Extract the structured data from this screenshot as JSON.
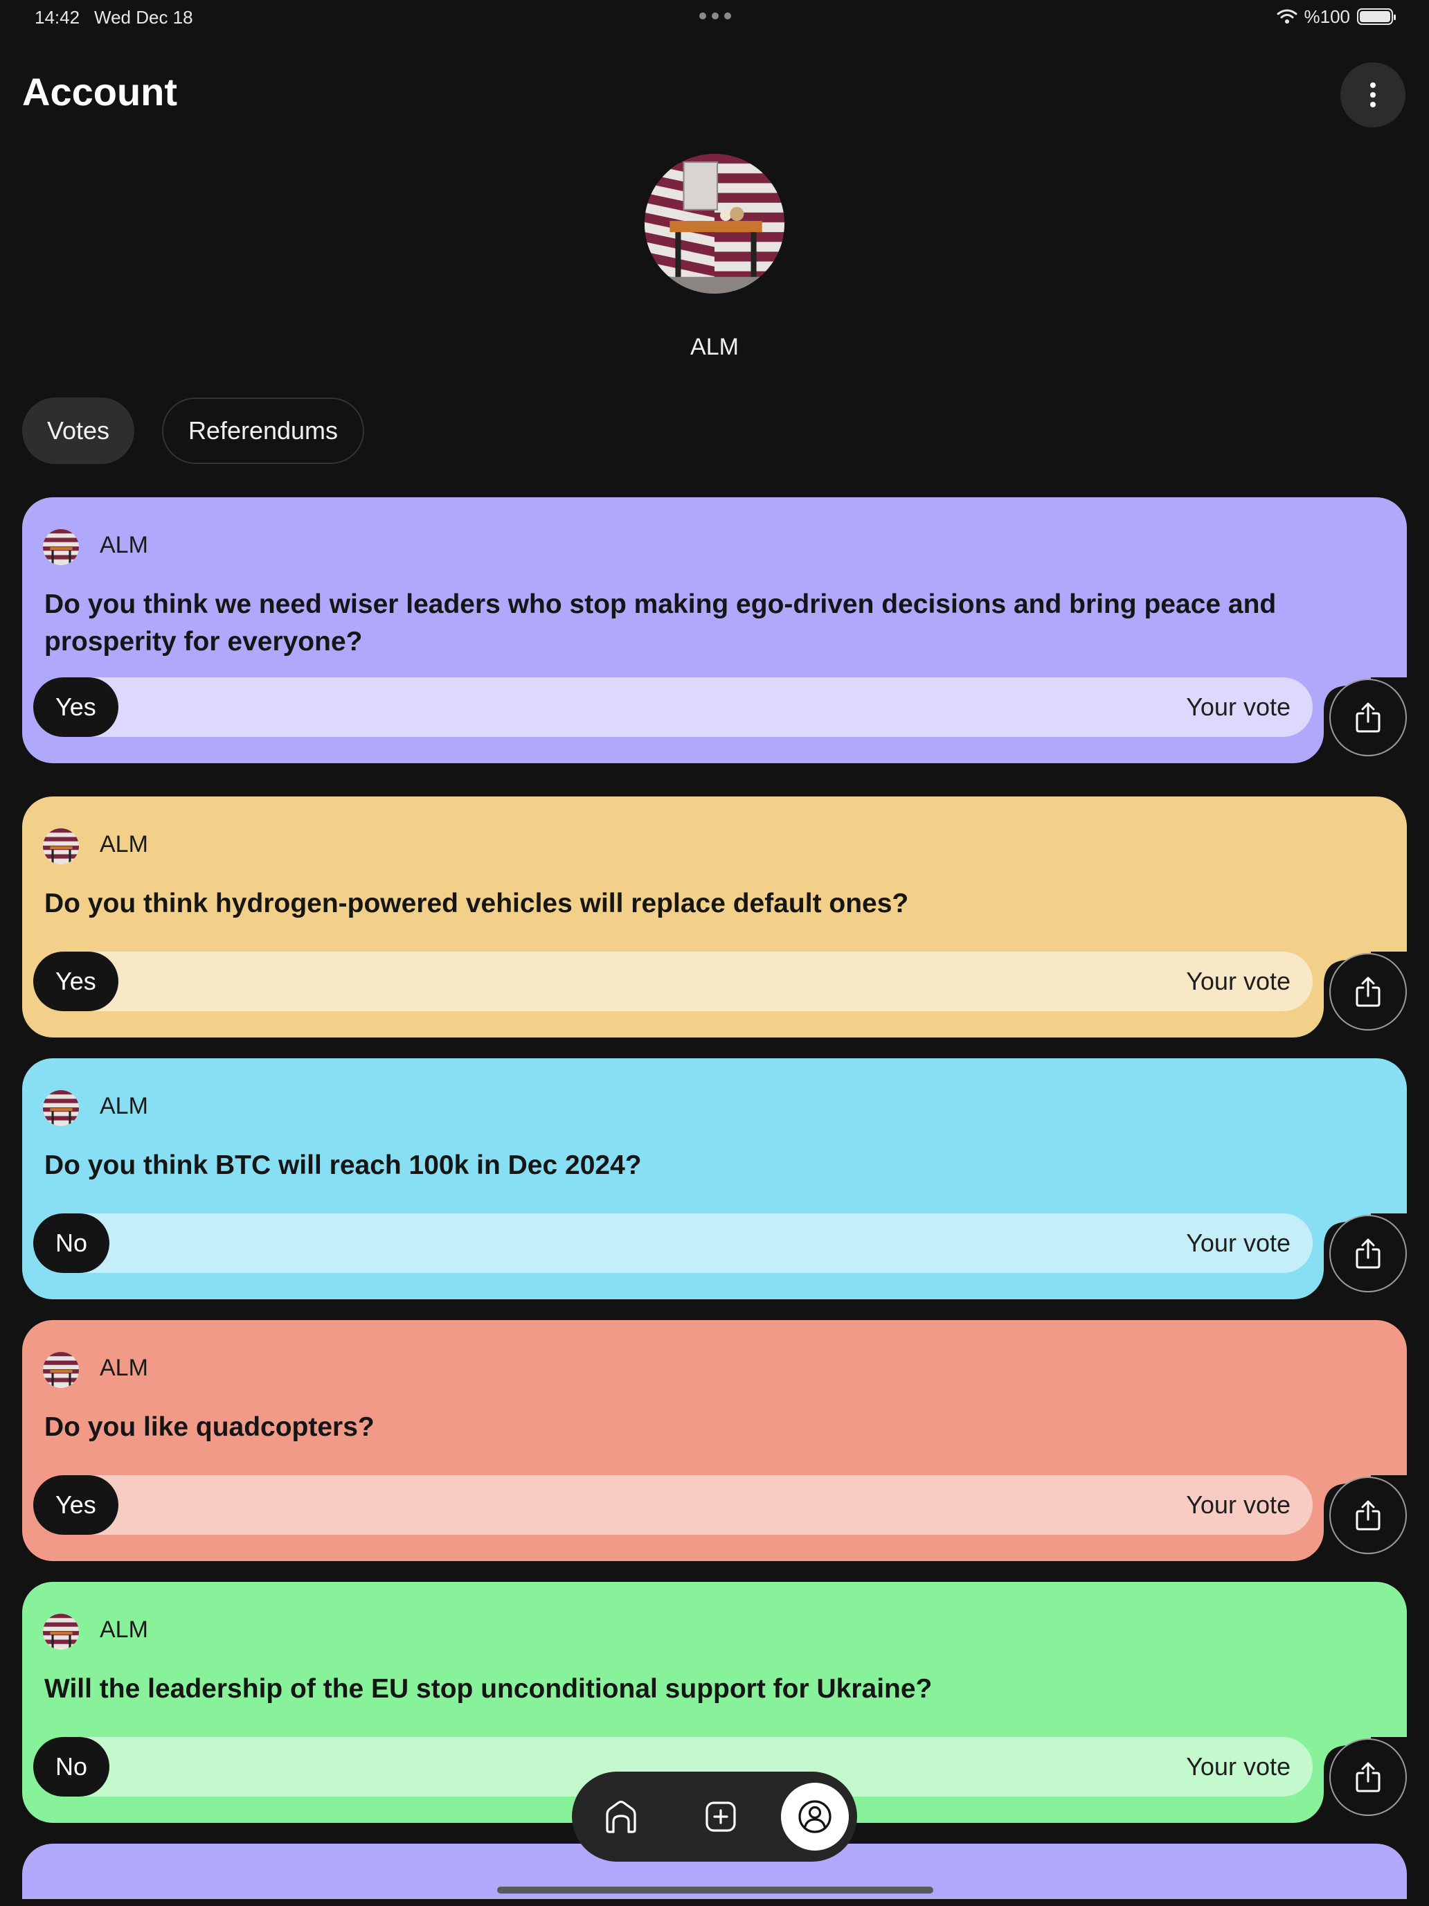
{
  "status_bar": {
    "time": "14:42",
    "date": "Wed Dec 18",
    "battery": "%100"
  },
  "header": {
    "title": "Account",
    "more_icon": "more-vertical-icon"
  },
  "profile": {
    "username": "ALM"
  },
  "tabs": [
    {
      "label": "Votes",
      "active": true
    },
    {
      "label": "Referendums",
      "active": false
    }
  ],
  "cards": [
    {
      "author": "ALM",
      "question": "Do you think we need wiser leaders who stop making ego-driven decisions and bring peace and prosperity for everyone?",
      "answer": "Yes",
      "vote_label": "Your vote",
      "color": "#b0a8fb",
      "bar_color": "#dcd8fe"
    },
    {
      "author": "ALM",
      "question": "Do you think hydrogen-powered vehicles will replace default ones?",
      "answer": "Yes",
      "vote_label": "Your vote",
      "color": "#f2d08a",
      "bar_color": "#f9e8c5"
    },
    {
      "author": "ALM",
      "question": "Do you think BTC will reach 100k in Dec 2024?",
      "answer": "No",
      "vote_label": "Your vote",
      "color": "#88dff3",
      "bar_color": "#c4eff8"
    },
    {
      "author": "ALM",
      "question": "Do you like quadcopters?",
      "answer": "Yes",
      "vote_label": "Your vote",
      "color": "#f19a87",
      "bar_color": "#f8ccc3"
    },
    {
      "author": "ALM",
      "question": "Will the leadership of the EU stop unconditional support for Ukraine?",
      "answer": "No",
      "vote_label": "Your vote",
      "color": "#88f29b",
      "bar_color": "#c4f9cd"
    }
  ],
  "bottom_nav": {
    "items": [
      {
        "icon": "home-icon",
        "active": false
      },
      {
        "icon": "add-square-icon",
        "active": false
      },
      {
        "icon": "account-icon",
        "active": true
      }
    ]
  }
}
